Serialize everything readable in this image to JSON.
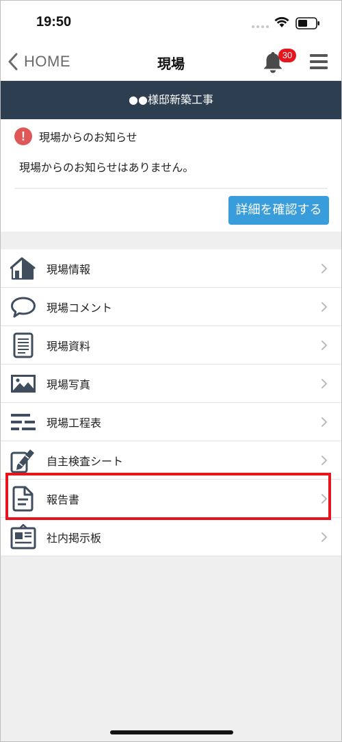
{
  "status_bar": {
    "time": "19:50"
  },
  "nav": {
    "back_label": "HOME",
    "title": "現場",
    "notification_count": "30"
  },
  "site": {
    "name": "●●様邸新築工事"
  },
  "notice": {
    "title": "現場からのお知らせ",
    "body": "現場からのお知らせはありません。",
    "detail_button": "詳細を確認する"
  },
  "menu_items": [
    {
      "label": "現場情報",
      "icon": "house-icon"
    },
    {
      "label": "現場コメント",
      "icon": "speech-bubble-icon"
    },
    {
      "label": "現場資料",
      "icon": "document-lines-icon"
    },
    {
      "label": "現場写真",
      "icon": "photo-icon"
    },
    {
      "label": "現場工程表",
      "icon": "schedule-bars-icon"
    },
    {
      "label": "自主検査シート",
      "icon": "tablet-pencil-icon"
    },
    {
      "label": "報告書",
      "icon": "report-file-icon"
    },
    {
      "label": "社内掲示板",
      "icon": "bulletin-board-icon"
    }
  ],
  "colors": {
    "banner_bg": "#2d3e50",
    "accent_button": "#3a9ddb",
    "alert": "#e05757",
    "badge": "#e8141c",
    "highlight_frame": "#e8141c",
    "icon": "#3f4d5f"
  }
}
